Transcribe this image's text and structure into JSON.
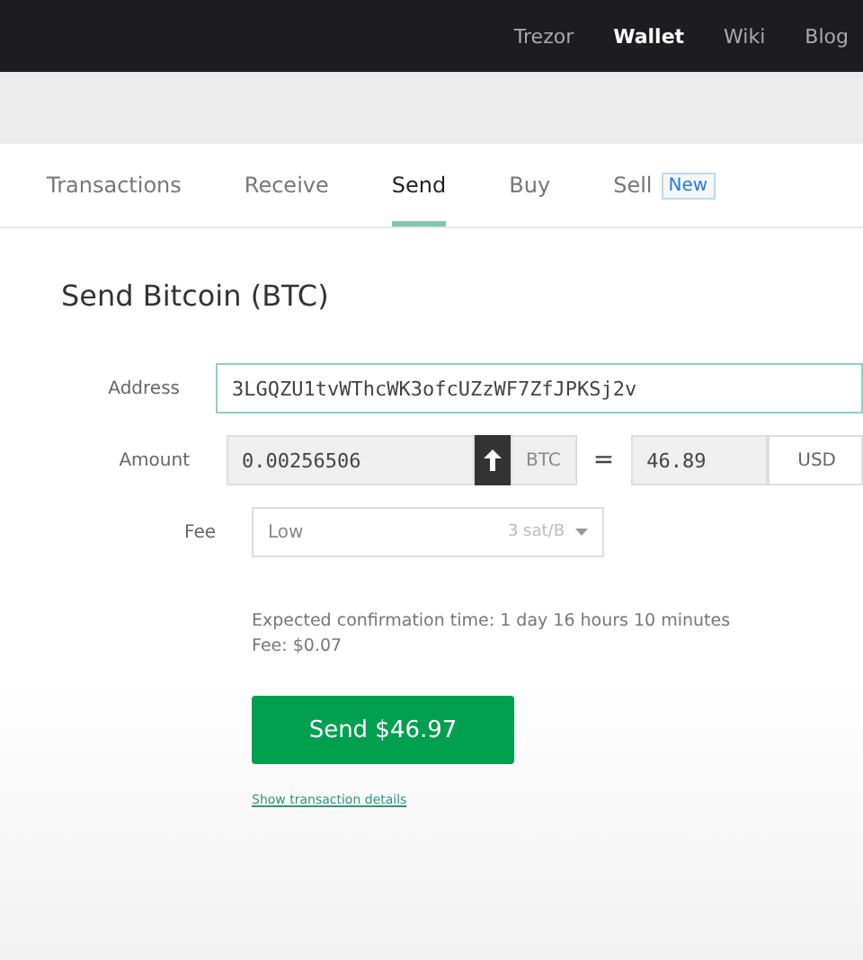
{
  "top_nav": [
    {
      "label": "Trezor",
      "selected": false
    },
    {
      "label": "Wallet",
      "selected": true
    },
    {
      "label": "Wiki",
      "selected": false
    },
    {
      "label": "Blog",
      "selected": false
    }
  ],
  "tabs": [
    {
      "label": "Transactions",
      "selected": false
    },
    {
      "label": "Receive",
      "selected": false
    },
    {
      "label": "Send",
      "selected": true
    },
    {
      "label": "Buy",
      "selected": false
    },
    {
      "label": "Sell",
      "selected": false,
      "badge": "New"
    }
  ],
  "heading": "Send Bitcoin (BTC)",
  "address": {
    "label": "Address",
    "value": "3LGQZU1tvWThcWK3ofcUZzWF7ZfJPKSj2v"
  },
  "amount": {
    "label": "Amount",
    "value": "0.00256506",
    "currency": "BTC",
    "equals": "=",
    "fiat_value": "46.89",
    "fiat_currency": "USD"
  },
  "fee": {
    "label": "Fee",
    "level": "Low",
    "rate": "3 sat/B"
  },
  "info": [
    "Expected confirmation time: 1 day 16 hours 10 minutes",
    "Fee: $0.07"
  ],
  "send_button": "Send $46.97",
  "details_link": "Show transaction details"
}
